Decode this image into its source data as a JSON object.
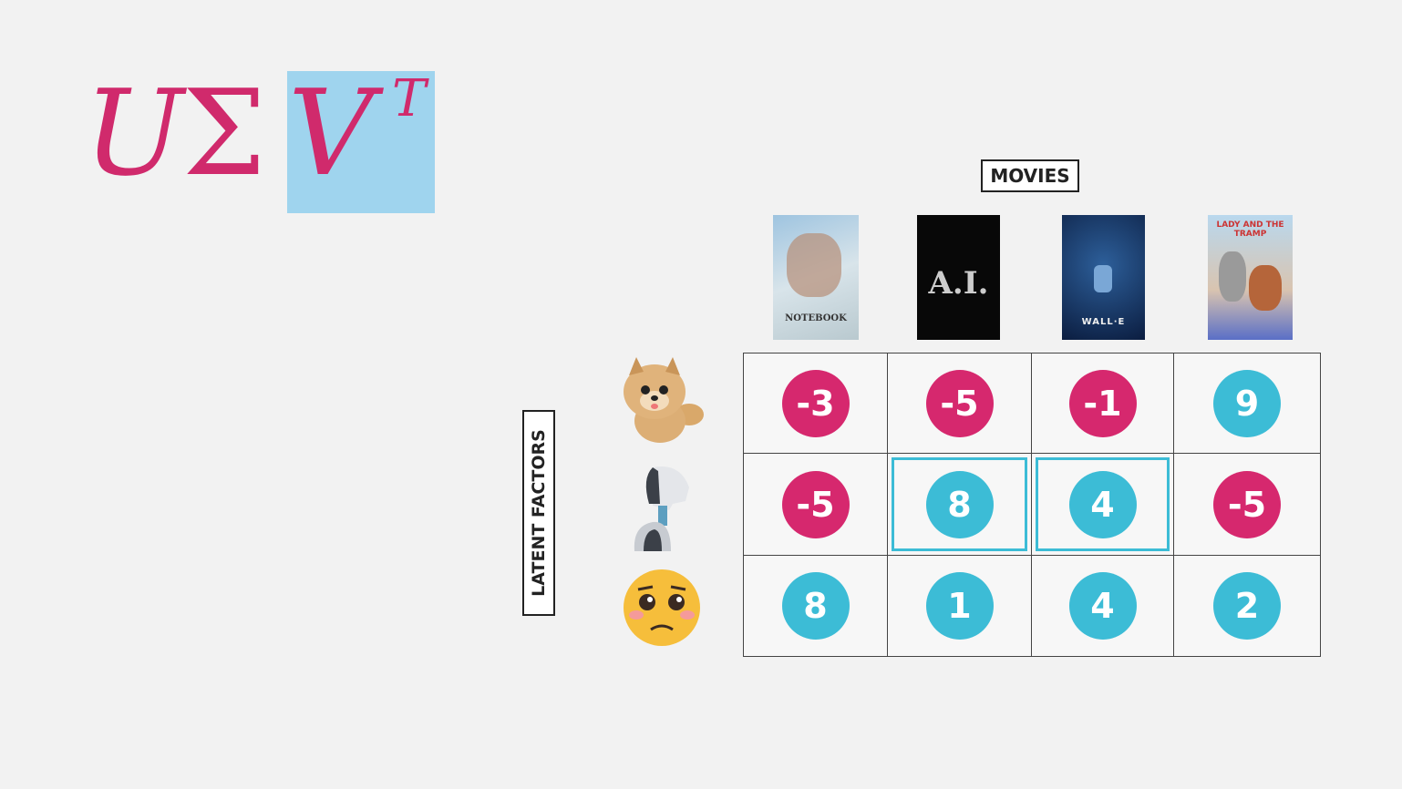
{
  "formula": {
    "u": "U",
    "sigma": "Σ",
    "v": "V",
    "t": "T"
  },
  "columns_label": "MOVIES",
  "rows_label": "LATENT FACTORS",
  "movies": [
    {
      "title": "NOTEBOOK",
      "icon": "notebook-poster"
    },
    {
      "title": "A.I.",
      "icon": "ai-poster"
    },
    {
      "title": "WALL·E",
      "icon": "walle-poster"
    },
    {
      "title": "LADY AND THE TRAMP",
      "icon": "lady-tramp-poster"
    }
  ],
  "factors": [
    {
      "icon": "dog-icon"
    },
    {
      "icon": "robot-icon"
    },
    {
      "icon": "sad-face-icon"
    }
  ],
  "matrix": [
    [
      -3,
      -5,
      -1,
      9
    ],
    [
      -5,
      8,
      4,
      -5
    ],
    [
      8,
      1,
      4,
      2
    ]
  ],
  "highlighted": [
    [
      1,
      1
    ],
    [
      1,
      2
    ]
  ],
  "colors": {
    "negative": "#d6286e",
    "positive": "#3cbcd6",
    "formula": "#d02a6c",
    "highlight_bg": "#9fd4ee"
  }
}
